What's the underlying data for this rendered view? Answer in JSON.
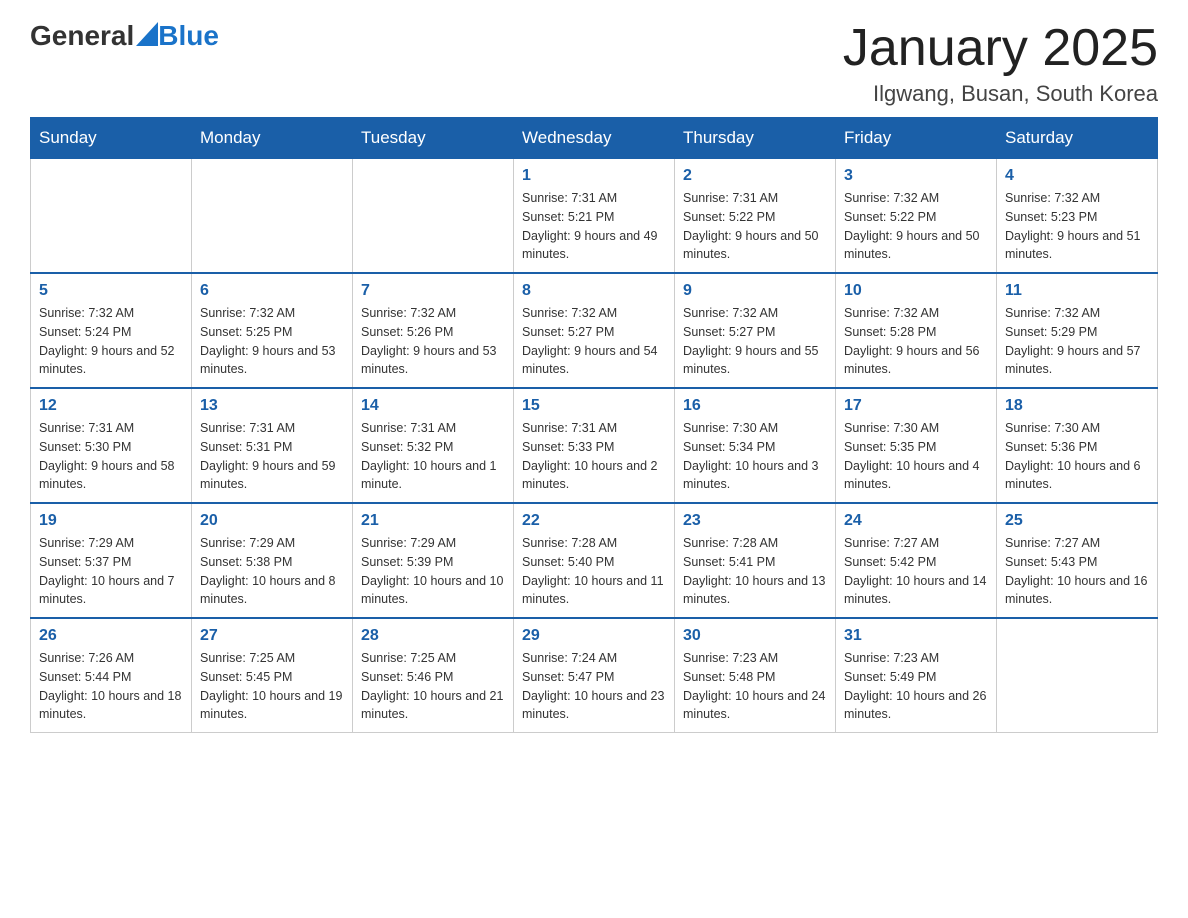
{
  "logo": {
    "general": "General",
    "blue": "Blue"
  },
  "title": "January 2025",
  "subtitle": "Ilgwang, Busan, South Korea",
  "weekdays": [
    "Sunday",
    "Monday",
    "Tuesday",
    "Wednesday",
    "Thursday",
    "Friday",
    "Saturday"
  ],
  "weeks": [
    [
      {
        "day": "",
        "info": ""
      },
      {
        "day": "",
        "info": ""
      },
      {
        "day": "",
        "info": ""
      },
      {
        "day": "1",
        "info": "Sunrise: 7:31 AM\nSunset: 5:21 PM\nDaylight: 9 hours and 49 minutes."
      },
      {
        "day": "2",
        "info": "Sunrise: 7:31 AM\nSunset: 5:22 PM\nDaylight: 9 hours and 50 minutes."
      },
      {
        "day": "3",
        "info": "Sunrise: 7:32 AM\nSunset: 5:22 PM\nDaylight: 9 hours and 50 minutes."
      },
      {
        "day": "4",
        "info": "Sunrise: 7:32 AM\nSunset: 5:23 PM\nDaylight: 9 hours and 51 minutes."
      }
    ],
    [
      {
        "day": "5",
        "info": "Sunrise: 7:32 AM\nSunset: 5:24 PM\nDaylight: 9 hours and 52 minutes."
      },
      {
        "day": "6",
        "info": "Sunrise: 7:32 AM\nSunset: 5:25 PM\nDaylight: 9 hours and 53 minutes."
      },
      {
        "day": "7",
        "info": "Sunrise: 7:32 AM\nSunset: 5:26 PM\nDaylight: 9 hours and 53 minutes."
      },
      {
        "day": "8",
        "info": "Sunrise: 7:32 AM\nSunset: 5:27 PM\nDaylight: 9 hours and 54 minutes."
      },
      {
        "day": "9",
        "info": "Sunrise: 7:32 AM\nSunset: 5:27 PM\nDaylight: 9 hours and 55 minutes."
      },
      {
        "day": "10",
        "info": "Sunrise: 7:32 AM\nSunset: 5:28 PM\nDaylight: 9 hours and 56 minutes."
      },
      {
        "day": "11",
        "info": "Sunrise: 7:32 AM\nSunset: 5:29 PM\nDaylight: 9 hours and 57 minutes."
      }
    ],
    [
      {
        "day": "12",
        "info": "Sunrise: 7:31 AM\nSunset: 5:30 PM\nDaylight: 9 hours and 58 minutes."
      },
      {
        "day": "13",
        "info": "Sunrise: 7:31 AM\nSunset: 5:31 PM\nDaylight: 9 hours and 59 minutes."
      },
      {
        "day": "14",
        "info": "Sunrise: 7:31 AM\nSunset: 5:32 PM\nDaylight: 10 hours and 1 minute."
      },
      {
        "day": "15",
        "info": "Sunrise: 7:31 AM\nSunset: 5:33 PM\nDaylight: 10 hours and 2 minutes."
      },
      {
        "day": "16",
        "info": "Sunrise: 7:30 AM\nSunset: 5:34 PM\nDaylight: 10 hours and 3 minutes."
      },
      {
        "day": "17",
        "info": "Sunrise: 7:30 AM\nSunset: 5:35 PM\nDaylight: 10 hours and 4 minutes."
      },
      {
        "day": "18",
        "info": "Sunrise: 7:30 AM\nSunset: 5:36 PM\nDaylight: 10 hours and 6 minutes."
      }
    ],
    [
      {
        "day": "19",
        "info": "Sunrise: 7:29 AM\nSunset: 5:37 PM\nDaylight: 10 hours and 7 minutes."
      },
      {
        "day": "20",
        "info": "Sunrise: 7:29 AM\nSunset: 5:38 PM\nDaylight: 10 hours and 8 minutes."
      },
      {
        "day": "21",
        "info": "Sunrise: 7:29 AM\nSunset: 5:39 PM\nDaylight: 10 hours and 10 minutes."
      },
      {
        "day": "22",
        "info": "Sunrise: 7:28 AM\nSunset: 5:40 PM\nDaylight: 10 hours and 11 minutes."
      },
      {
        "day": "23",
        "info": "Sunrise: 7:28 AM\nSunset: 5:41 PM\nDaylight: 10 hours and 13 minutes."
      },
      {
        "day": "24",
        "info": "Sunrise: 7:27 AM\nSunset: 5:42 PM\nDaylight: 10 hours and 14 minutes."
      },
      {
        "day": "25",
        "info": "Sunrise: 7:27 AM\nSunset: 5:43 PM\nDaylight: 10 hours and 16 minutes."
      }
    ],
    [
      {
        "day": "26",
        "info": "Sunrise: 7:26 AM\nSunset: 5:44 PM\nDaylight: 10 hours and 18 minutes."
      },
      {
        "day": "27",
        "info": "Sunrise: 7:25 AM\nSunset: 5:45 PM\nDaylight: 10 hours and 19 minutes."
      },
      {
        "day": "28",
        "info": "Sunrise: 7:25 AM\nSunset: 5:46 PM\nDaylight: 10 hours and 21 minutes."
      },
      {
        "day": "29",
        "info": "Sunrise: 7:24 AM\nSunset: 5:47 PM\nDaylight: 10 hours and 23 minutes."
      },
      {
        "day": "30",
        "info": "Sunrise: 7:23 AM\nSunset: 5:48 PM\nDaylight: 10 hours and 24 minutes."
      },
      {
        "day": "31",
        "info": "Sunrise: 7:23 AM\nSunset: 5:49 PM\nDaylight: 10 hours and 26 minutes."
      },
      {
        "day": "",
        "info": ""
      }
    ]
  ]
}
